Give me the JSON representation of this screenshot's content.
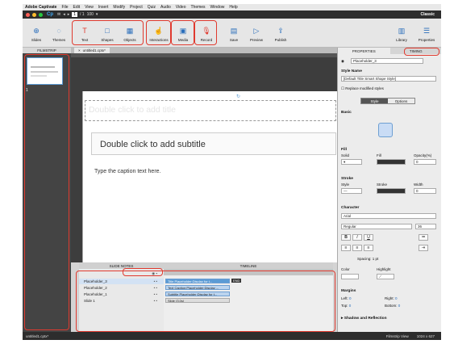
{
  "menubar": {
    "brand": "Adobe Captivate",
    "items": [
      "File",
      "Edit",
      "View",
      "Insert",
      "Modify",
      "Project",
      "Quiz",
      "Audio",
      "Video",
      "Themes",
      "Window",
      "Help"
    ]
  },
  "titlebar": {
    "logo": "Cp",
    "page_current": "1",
    "page_total": "/ 1",
    "zoom": "100",
    "mode": "Classic"
  },
  "toolbar": {
    "slides": "Slides",
    "themes": "Themes",
    "text": "Text",
    "shapes": "Shapes",
    "objects": "Objects",
    "interactions": "Interactions",
    "media": "Media",
    "record": "Record",
    "save": "Save",
    "preview": "Preview",
    "publish": "Publish",
    "library": "Library",
    "properties": "Properties"
  },
  "filmstrip": {
    "header": "FILMSTRIP",
    "slide_number": "1"
  },
  "document": {
    "tab": "untitled1.cptx*"
  },
  "slide": {
    "title_placeholder": "Double click to add title",
    "subtitle_placeholder": "Double click to add subtitle",
    "caption_placeholder": "Type the caption text here."
  },
  "timeline": {
    "slide_notes": "SLIDE NOTES",
    "header": "TIMELINE",
    "rows": [
      {
        "name": "Placeholder_3",
        "bar": "Title Placeholder:Display for t..."
      },
      {
        "name": "Placeholder_2",
        "bar": "Text Caption:Placeholder:Display ..."
      },
      {
        "name": "Placeholder_1",
        "bar": "Subtitle Placeholder:Display for t..."
      },
      {
        "name": "Slide 1",
        "bar": "Slide (3.0s)"
      }
    ],
    "end_marker": "END",
    "footer": [
      "0.0s",
      "0.0s",
      "3.0s",
      "3.0s"
    ]
  },
  "properties": {
    "tabs": [
      "PROPERTIES",
      "TIMING"
    ],
    "object_name": "Placeholder_3",
    "style_name_label": "Style Name",
    "style_name_value": "[Default Title Smart Shape Style]",
    "replace_styles": "Replace modified styles",
    "style_tab": "Style",
    "options_tab": "Options",
    "basic": "Basic",
    "fill": "Fill",
    "fill_type": "Solid",
    "fill_label": "Fill",
    "opacity_label": "Opacity(%)",
    "opacity_value": "0",
    "stroke": "Stroke",
    "stroke_style": "Style",
    "stroke_label": "Stroke",
    "width_label": "Width",
    "width_value": "0",
    "character": "Character",
    "font": "Arial",
    "font_style": "Regular",
    "font_size": "36",
    "spacing": "Spacing: 1 pt",
    "color_label": "Color",
    "highlight_label": "Highlight",
    "margins": "Margins",
    "left": "Left:",
    "left_value": "0",
    "right": "Right:",
    "right_value": "0",
    "top": "Top:",
    "top_value": "0",
    "bottom": "Bottom:",
    "bottom_value": "0",
    "shadow": "Shadow and Reflection"
  },
  "status": {
    "file": "untitled1.cptx*",
    "view": "Filmstrip View",
    "size": "1024 x 627"
  }
}
